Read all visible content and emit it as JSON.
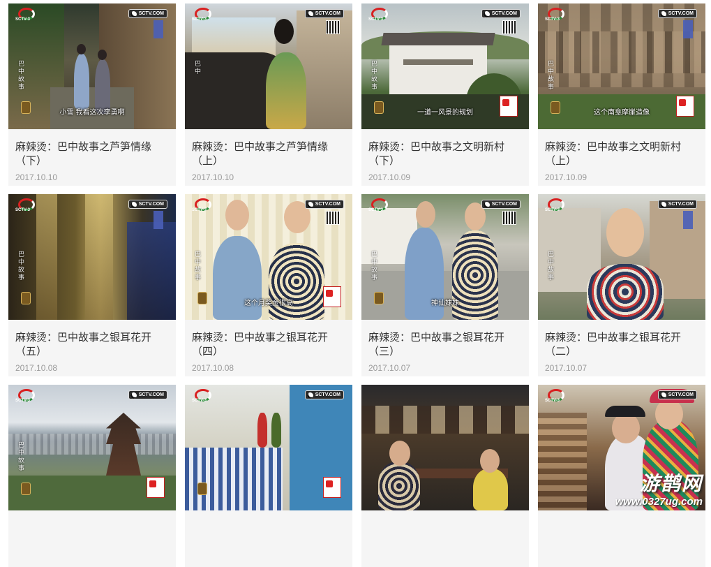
{
  "videos": [
    {
      "title": "麻辣烫：巴中故事之芦笋情缘（下）",
      "date": "2017.10.10",
      "subtitle": "小雪  我看这次李勇啊",
      "channel_text": "巴中故事",
      "scene": "alley"
    },
    {
      "title": "麻辣烫：巴中故事之芦笋情缘（上）",
      "date": "2017.10.10",
      "subtitle": "",
      "channel_text": "巴中",
      "scene": "car"
    },
    {
      "title": "麻辣烫：巴中故事之文明新村（下）",
      "date": "2017.10.09",
      "subtitle": "一道一风景的规划",
      "channel_text": "巴中故事",
      "scene": "village"
    },
    {
      "title": "麻辣烫：巴中故事之文明新村（上）",
      "date": "2017.10.09",
      "subtitle": "这个南龛摩崖造像",
      "channel_text": "巴中故事",
      "scene": "cliff"
    },
    {
      "title": "麻辣烫：巴中故事之银耳花开（五）",
      "date": "2017.10.08",
      "subtitle": "",
      "channel_text": "巴中故事",
      "scene": "cave"
    },
    {
      "title": "麻辣烫：巴中故事之银耳花开（四）",
      "date": "2017.10.08",
      "subtitle": "这个月奖金很高",
      "channel_text": "巴中故事",
      "scene": "indoor"
    },
    {
      "title": "麻辣烫：巴中故事之银耳花开（三）",
      "date": "2017.10.07",
      "subtitle": "神仙妹妹",
      "channel_text": "巴中故事",
      "scene": "street"
    },
    {
      "title": "麻辣烫：巴中故事之银耳花开（二）",
      "date": "2017.10.07",
      "subtitle": "",
      "channel_text": "巴中故事",
      "scene": "closeup"
    },
    {
      "title": "",
      "date": "",
      "subtitle": "",
      "channel_text": "巴中故事",
      "scene": "city"
    },
    {
      "title": "",
      "date": "",
      "subtitle": "",
      "channel_text": "",
      "scene": "hospital"
    },
    {
      "title": "",
      "date": "",
      "subtitle": "",
      "channel_text": "",
      "scene": "tea"
    },
    {
      "title": "",
      "date": "",
      "subtitle": "",
      "channel_text": "",
      "scene": "hat"
    }
  ],
  "overlay": {
    "channel_logo_left": "SCTV-3",
    "channel_logo_right": "SCTV.COM"
  },
  "watermark": {
    "name": "游鹊网",
    "url": "www.0327ug.com"
  },
  "colors": {
    "card_bg": "#f5f5f5",
    "title_text": "#333333",
    "date_text": "#9a9a9a"
  }
}
